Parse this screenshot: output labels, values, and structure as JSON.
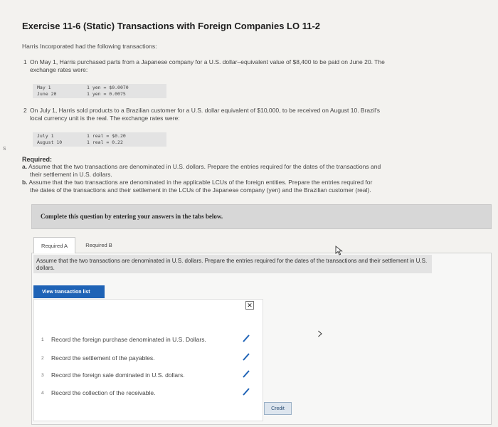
{
  "title": "Exercise 11-6 (Static) Transactions with Foreign Companies LO 11-2",
  "intro": "Harris Incorporated had the following transactions:",
  "items": [
    {
      "num": "1",
      "text_line1": "On May 1, Harris purchased parts from a Japanese company for a U.S. dollar–equivalent value of $8,400 to be paid on June 20. The",
      "text_line2": "exchange rates were:",
      "rates": [
        {
          "date": "May 1",
          "rate": "1 yen = $0.0070"
        },
        {
          "date": "June 20",
          "rate": "1 yen = 0.0075"
        }
      ]
    },
    {
      "num": "2",
      "text_line1": "On July 1, Harris sold products to a Brazilian customer for a U.S. dollar equivalent of $10,000, to be received on August 10. Brazil's",
      "text_line2": "local currency unit is the real. The exchange rates were:",
      "rates": [
        {
          "date": "July 1",
          "rate": "1 real = $0.20"
        },
        {
          "date": "August 10",
          "rate": "1 real = 0.22"
        }
      ]
    }
  ],
  "required": {
    "heading": "Required:",
    "a_letter": "a.",
    "a_line1": "Assume that the two transactions are denominated in U.S. dollars. Prepare the entries required for the dates of the transactions and",
    "a_line2": "their settlement in U.S. dollars.",
    "b_letter": "b.",
    "b_line1": "Assume that the two transactions are denominated in the applicable LCUs of the foreign entities. Prepare the entries required for",
    "b_line2": "the dates of the transactions and their settlement in the LCUs of the Japanese company (yen) and the Brazilian customer (real)."
  },
  "banner": "Complete this question by entering your answers in the tabs below.",
  "tabs": [
    {
      "label": "Required A",
      "active": true
    },
    {
      "label": "Required B",
      "active": false
    }
  ],
  "instruction": "Assume that the two transactions are denominated in U.S. dollars. Prepare the entries required for the dates of the transactions and their settlement in U.S. dollars.",
  "view_button": "View transaction list",
  "close_symbol": "✕",
  "transactions": [
    {
      "num": "1",
      "label": "Record the foreign purchase denominated in U.S. Dollars."
    },
    {
      "num": "2",
      "label": "Record the settlement of the payables."
    },
    {
      "num": "3",
      "label": "Record the foreign sale dominated in U.S. dollars."
    },
    {
      "num": "4",
      "label": "Record the collection of the receivable."
    }
  ],
  "credit_button": "Credit",
  "left_mark": "s",
  "colors": {
    "accent": "#1f63b6",
    "background": "#f3f2ef",
    "banner": "#d7d7d7"
  }
}
